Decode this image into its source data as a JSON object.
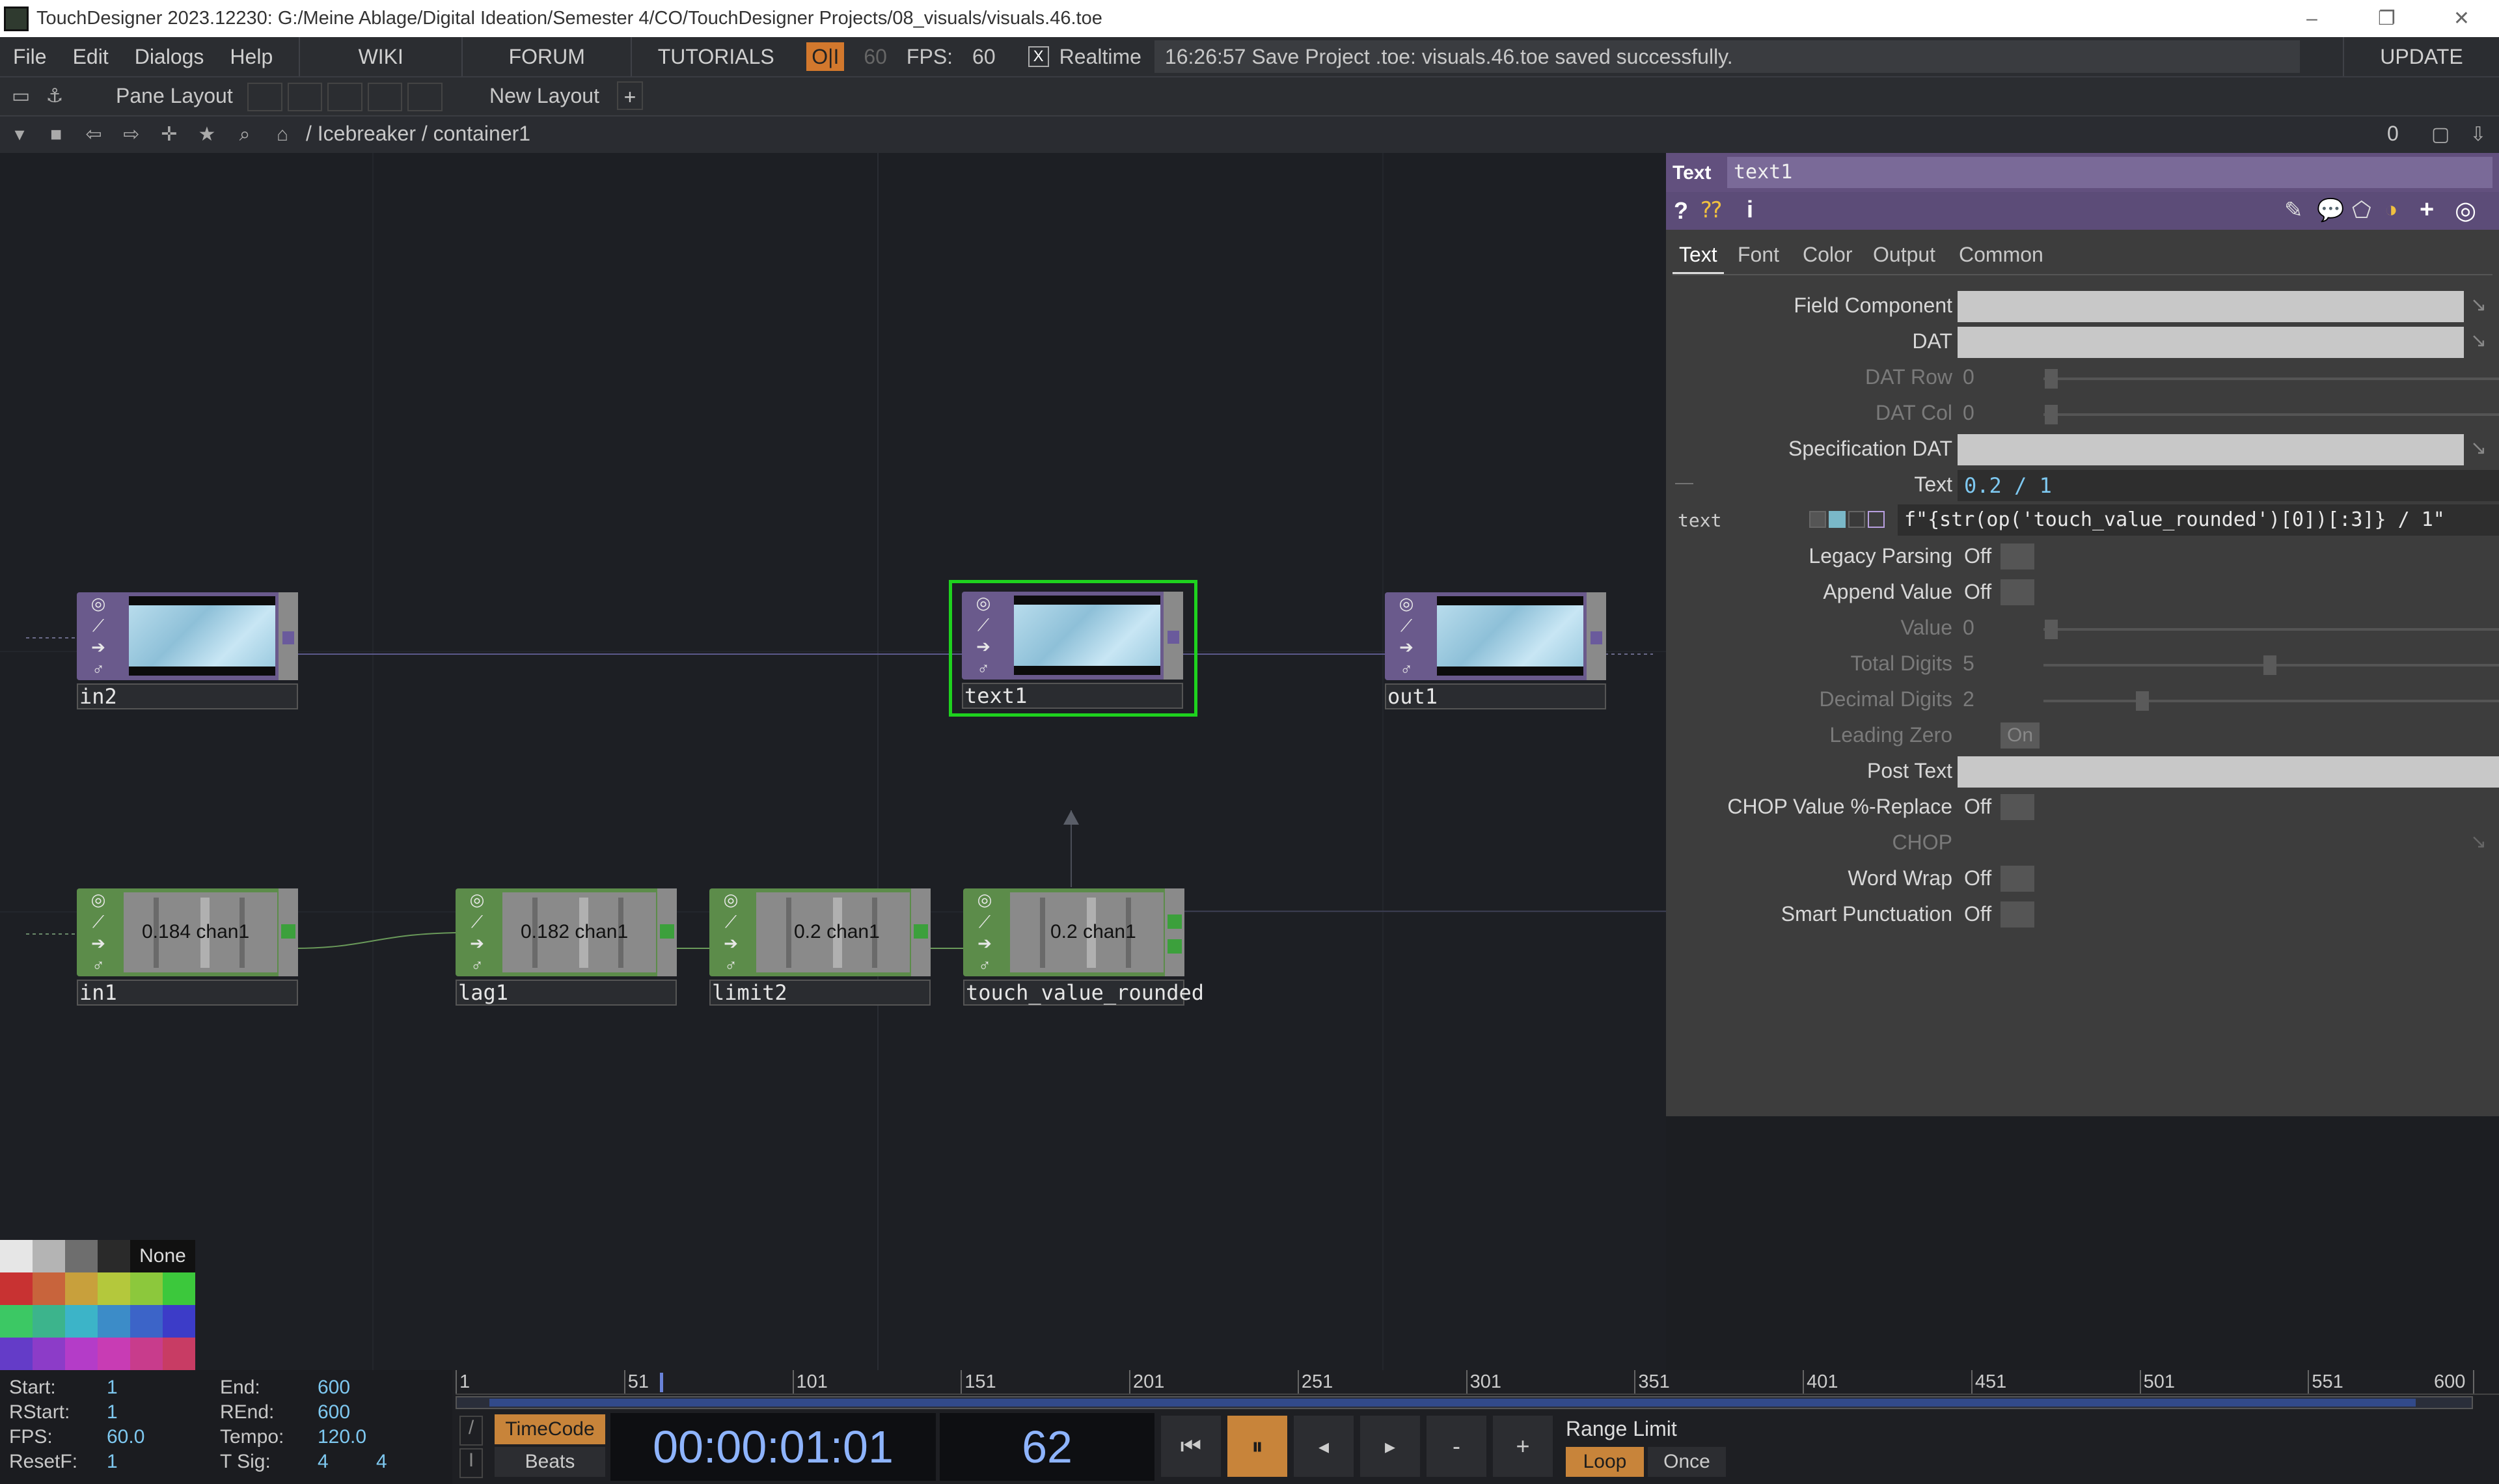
{
  "window": {
    "title": "TouchDesigner 2023.12230: G:/Meine Ablage/Digital Ideation/Semester 4/CO/TouchDesigner Projects/08_visuals/visuals.46.toe",
    "min": "–",
    "max": "❐",
    "close": "✕"
  },
  "menu": {
    "items": [
      "File",
      "Edit",
      "Dialogs",
      "Help"
    ],
    "wiki": "WIKI",
    "forum": "FORUM",
    "tutorials": "TUTORIALS",
    "oi": "O|I",
    "fps_target": "60",
    "fps_label": "FPS:",
    "fps_value": "60",
    "realtime_check": "X",
    "realtime": "Realtime",
    "status": "16:26:57 Save Project .toe: visuals.46.toe saved successfully.",
    "update": "UPDATE"
  },
  "layout_bar": {
    "pane_layout": "Pane Layout",
    "new_layout": "New Layout",
    "add": "+"
  },
  "path_bar": {
    "path": "/ Icebreaker / container1",
    "pane_index": "0"
  },
  "nodes": {
    "in2": "in2",
    "text1": "text1",
    "out1": "out1",
    "in1": "in1",
    "in1_val": "0.184",
    "lag1": "lag1",
    "lag1_val": "0.182",
    "limit2": "limit2",
    "limit2_val": "0.2",
    "touch": "touch_value_rounded",
    "touch_val": "0.2",
    "chan": "chan1"
  },
  "params": {
    "op_type": "Text",
    "op_name": "text1",
    "tabs": [
      "Text",
      "Font",
      "Color",
      "Output",
      "Common"
    ],
    "field_component": "Field Component",
    "dat": "DAT",
    "dat_row": "DAT Row",
    "dat_row_val": "0",
    "dat_col": "DAT Col",
    "dat_col_val": "0",
    "spec_dat": "Specification DAT",
    "text_label": "Text",
    "text_value": "0.2 / 1",
    "text_dash": "—",
    "expr_name": "text",
    "expr": "f\"{str(op('touch_value_rounded')[0])[:3]} / 1\"",
    "legacy": "Legacy Parsing",
    "append": "Append Value",
    "value": "Value",
    "value_val": "0",
    "total_digits": "Total Digits",
    "total_digits_val": "5",
    "decimal_digits": "Decimal Digits",
    "decimal_digits_val": "2",
    "leading_zero": "Leading Zero",
    "on": "On",
    "post_text": "Post Text",
    "chop_replace": "CHOP Value %-Replace",
    "chop": "CHOP",
    "word_wrap": "Word Wrap",
    "smart_punct": "Smart Punctuation",
    "off": "Off"
  },
  "palette": {
    "none": "None",
    "colors": [
      "#e6e6e6",
      "#b4b4b4",
      "#6e6e6e",
      "#2a2a2a",
      "#c83232",
      "#c8643c",
      "#c8a03c",
      "#b4c83c",
      "#8cc83c",
      "#3cc83c",
      "#3cc864",
      "#3cb48c",
      "#3cb4c8",
      "#3c8cc8",
      "#3c64c8",
      "#3c3cc8",
      "#643cc8",
      "#8c3cc8",
      "#b43cc8",
      "#c83cb4",
      "#c83c8c",
      "#c83c64"
    ]
  },
  "time": {
    "start_label": "Start:",
    "start": "1",
    "rstart_label": "RStart:",
    "rstart": "1",
    "fps_label": "FPS:",
    "fps": "60.0",
    "resetf_label": "ResetF:",
    "resetf": "1",
    "end_label": "End:",
    "end": "600",
    "rend_label": "REnd:",
    "rend": "600",
    "tempo_label": "Tempo:",
    "tempo": "120.0",
    "tsig_label": "T Sig:",
    "tsig_a": "4",
    "tsig_b": "4",
    "ticks": [
      "1",
      "51",
      "101",
      "151",
      "201",
      "251",
      "301",
      "351",
      "401",
      "451",
      "501",
      "551",
      "600"
    ],
    "timecode": "TimeCode",
    "beats": "Beats",
    "clock": "00:00:01:01",
    "frame": "62",
    "range_limit": "Range Limit",
    "loop": "Loop",
    "once": "Once",
    "minus": "-",
    "plus": "+"
  }
}
